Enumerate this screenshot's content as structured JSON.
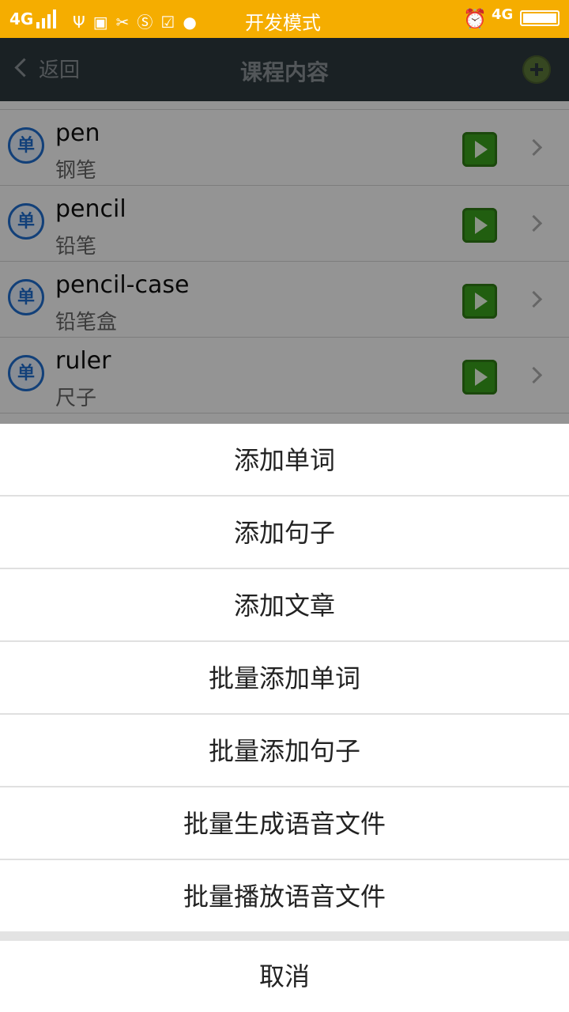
{
  "status_bar": {
    "network_left": "4G",
    "mode_label": "开发模式",
    "network_right": "4G",
    "icons": [
      "usb-icon",
      "usb-debug-icon",
      "tools-icon",
      "s-icon",
      "clipboard-check-icon",
      "chat-icon",
      "alarm-icon",
      "battery-icon"
    ]
  },
  "header": {
    "back_label": "返回",
    "title": "课程内容",
    "add_icon": "add-circle-icon"
  },
  "list": {
    "badge_label": "单",
    "items": [
      {
        "word": "pen",
        "meaning": "钢笔"
      },
      {
        "word": "pencil",
        "meaning": "铅笔"
      },
      {
        "word": "pencil-case",
        "meaning": "铅笔盒"
      },
      {
        "word": "ruler",
        "meaning": "尺子"
      }
    ]
  },
  "action_sheet": {
    "items": [
      {
        "label": "添加单词"
      },
      {
        "label": "添加句子"
      },
      {
        "label": "添加文章"
      },
      {
        "label": "批量添加单词"
      },
      {
        "label": "批量添加句子"
      },
      {
        "label": "批量生成语音文件"
      },
      {
        "label": "批量播放语音文件"
      }
    ],
    "cancel_label": "取消"
  },
  "colors": {
    "status_bar": "#f5ad00",
    "header": "#2e3a3f",
    "play_button": "#3aa21c",
    "badge": "#1f6fd1"
  }
}
